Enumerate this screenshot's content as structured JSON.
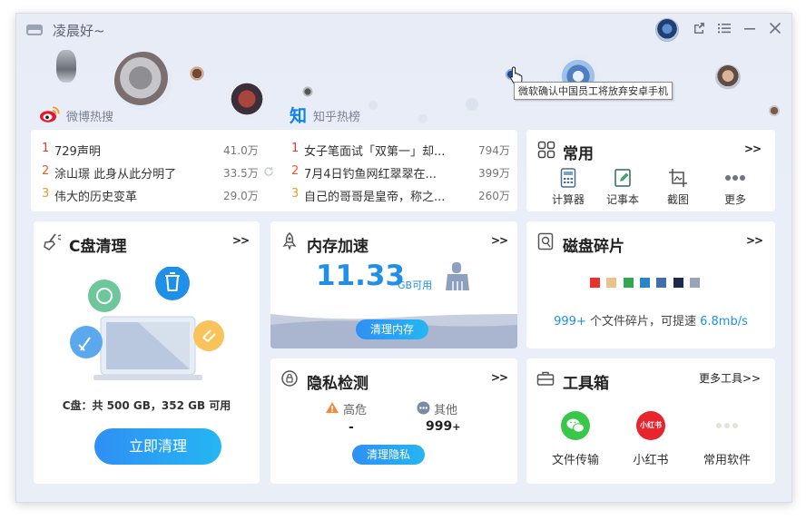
{
  "app": {
    "title": "凌晨好~"
  },
  "tooltip": "微软确认中国员工将放弃安卓手机",
  "weibo": {
    "label": "微博热搜",
    "items": [
      {
        "rank": "1",
        "text": "729声明",
        "count": "41.0万"
      },
      {
        "rank": "2",
        "text": "涂山璟 此身从此分明了",
        "count": "33.5万"
      },
      {
        "rank": "3",
        "text": "伟大的历史变革",
        "count": "29.0万"
      }
    ]
  },
  "zhihu": {
    "label": "知乎热榜",
    "icon_text": "知",
    "items": [
      {
        "rank": "1",
        "text": "女子笔面试「双第一」却...",
        "count": "794万"
      },
      {
        "rank": "2",
        "text": "7月4日钓鱼网红翠翠在...",
        "count": "399万"
      },
      {
        "rank": "3",
        "text": "自己的哥哥是皇帝，称之...",
        "count": "260万"
      }
    ]
  },
  "common": {
    "title": "常用",
    "more": ">>",
    "tools": [
      {
        "label": "计算器",
        "icon": "calculator-icon"
      },
      {
        "label": "记事本",
        "icon": "notepad-icon"
      },
      {
        "label": "截图",
        "icon": "screenshot-icon"
      },
      {
        "label": "更多",
        "icon": "more-dots-icon"
      }
    ]
  },
  "cclean": {
    "title": "C盘清理",
    "more": ">>",
    "disk_info": "C盘：共 500 GB，352 GB 可用",
    "button": "立即清理"
  },
  "memory": {
    "title": "内存加速",
    "more": ">>",
    "value": "11.33",
    "unit": "GB可用",
    "button": "清理内存"
  },
  "disk": {
    "title": "磁盘碎片",
    "more": ">>",
    "fragments": "999+",
    "desc_mid": " 个文件碎片，可提速 ",
    "speed": "6.8mb/s",
    "colors": [
      "#e8322b",
      "#e8c48c",
      "#2fa84f",
      "#2a85c8",
      "#3f6fae",
      "#1d2a4d",
      "#9aa3b8"
    ]
  },
  "privacy": {
    "title": "隐私检测",
    "more": ">>",
    "high_label": "高危",
    "high_value": "-",
    "other_label": "其他",
    "other_value": "999",
    "other_suffix": "+",
    "button": "清理隐私"
  },
  "toolbox": {
    "title": "工具箱",
    "more": "更多工具>>",
    "tools": [
      {
        "label": "文件传输",
        "icon": "wechat-icon",
        "color": "#39c74a"
      },
      {
        "label": "小红书",
        "icon": "xiaohongshu-icon",
        "color": "#e8242f",
        "badge": "小红书"
      },
      {
        "label": "常用软件",
        "icon": "more-dots-icon"
      }
    ]
  },
  "accent": "#1f8fe8"
}
